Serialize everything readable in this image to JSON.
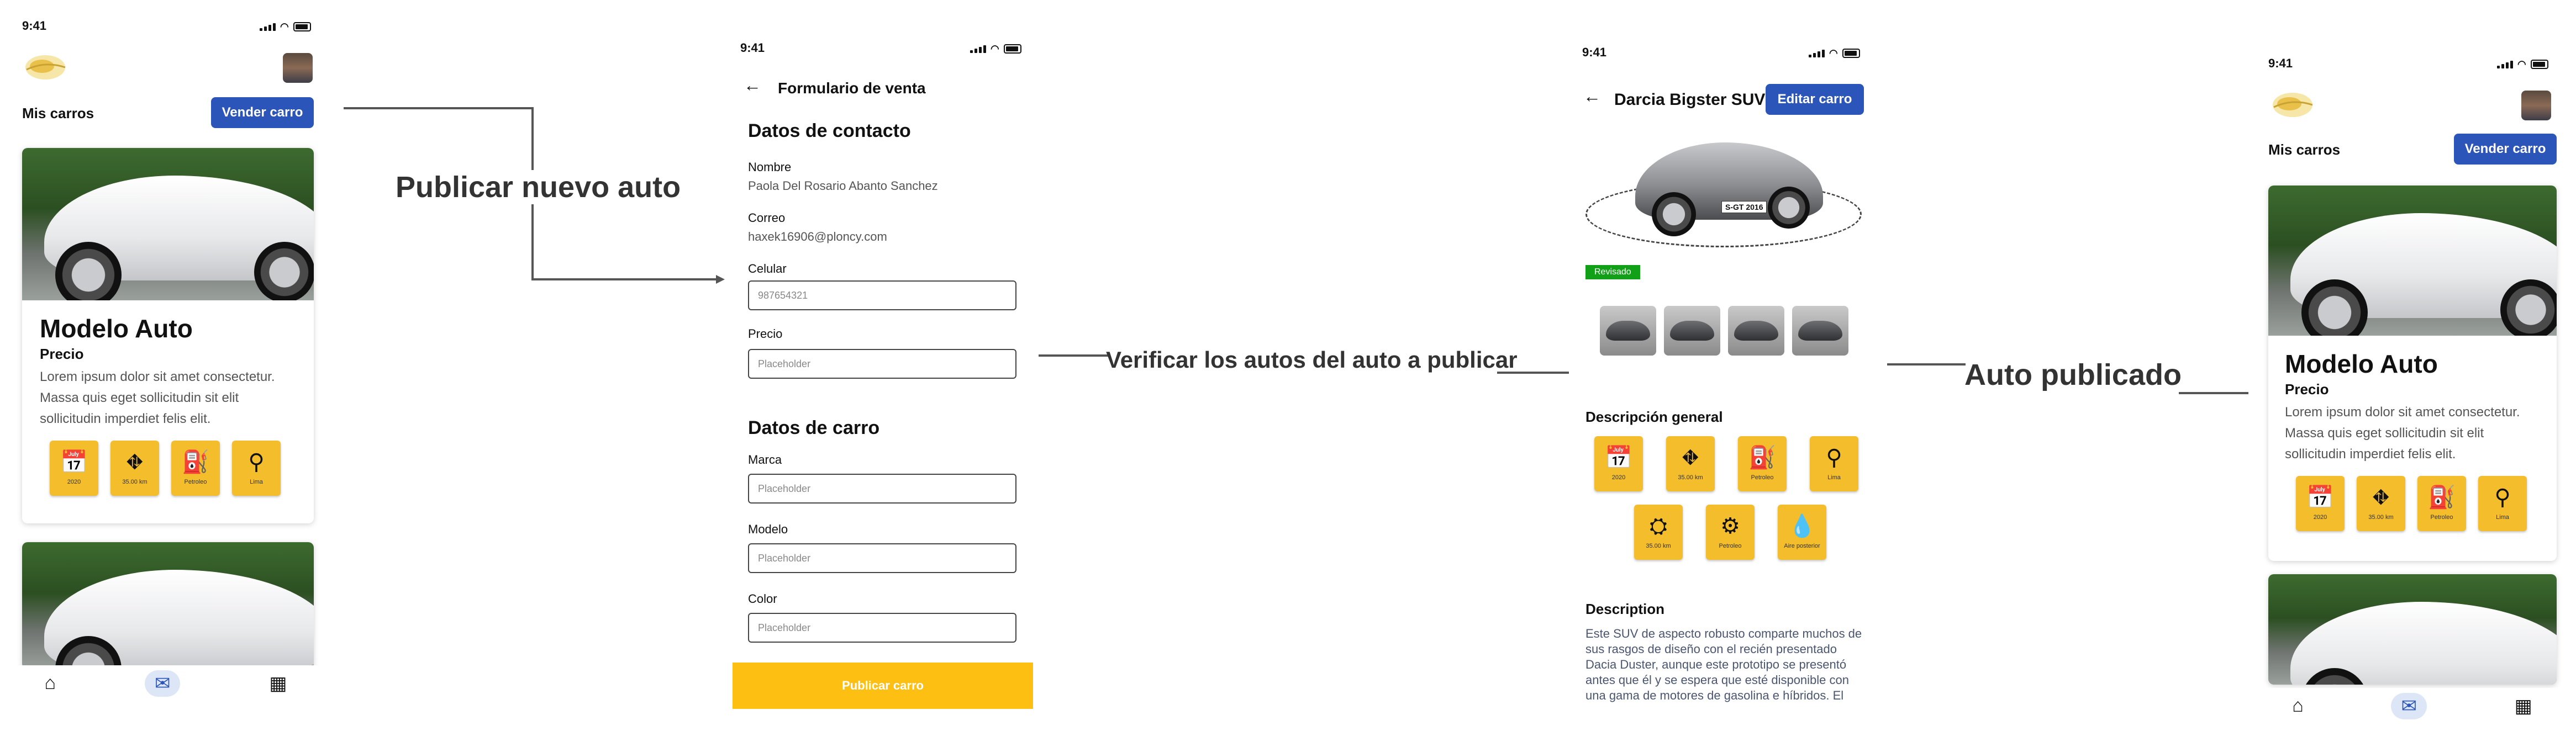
{
  "status": {
    "time": "9:41"
  },
  "flow": {
    "step1": "Publicar nuevo auto",
    "step2": "Verificar los autos del auto a publicar",
    "step3": "Auto publicado"
  },
  "list_screen": {
    "title": "Mis carros",
    "sell_button": "Vender carro",
    "card": {
      "model": "Modelo Auto",
      "price": "Precio",
      "description": "Lorem ipsum dolor sit amet consectetur. Massa quis eget sollicitudin sit elit sollicitudin imperdiet felis elit.",
      "features": [
        {
          "icon": "calendar-icon",
          "glyph": "📅",
          "label": "2020"
        },
        {
          "icon": "road-icon",
          "glyph": "⛖",
          "label": "35.00 km"
        },
        {
          "icon": "fuel-icon",
          "glyph": "⛽",
          "label": "Petroleo"
        },
        {
          "icon": "location-icon",
          "glyph": "⚲",
          "label": "Lima"
        }
      ]
    }
  },
  "form_screen": {
    "title": "Formulario de venta",
    "contact_section": "Datos de contacto",
    "name_label": "Nombre",
    "name_value": "Paola Del Rosario Abanto Sanchez",
    "email_label": "Correo",
    "email_value": "haxek16906@ploncy.com",
    "phone_label": "Celular",
    "phone_placeholder": "987654321",
    "price_label": "Precio",
    "price_placeholder": "Placeholder",
    "car_section": "Datos de carro",
    "brand_label": "Marca",
    "brand_placeholder": "Placeholder",
    "model_label": "Modelo",
    "model_placeholder": "Placeholder",
    "color_label": "Color",
    "color_placeholder": "Placeholder",
    "publish_button": "Publicar carro"
  },
  "detail_screen": {
    "title": "Darcia Bigster SUV",
    "edit_button": "Editar carro",
    "plate": "S-GT 2016",
    "badge": "Revisado",
    "badge_color": "#12a019",
    "overview_title": "Descripción general",
    "features_row1": [
      {
        "icon": "calendar-icon",
        "glyph": "📅",
        "label": "2020"
      },
      {
        "icon": "road-icon",
        "glyph": "⛖",
        "label": "35.00 km"
      },
      {
        "icon": "fuel-icon",
        "glyph": "⛽",
        "label": "Petroleo"
      },
      {
        "icon": "location-icon",
        "glyph": "⚲",
        "label": "Lima"
      }
    ],
    "features_row2": [
      {
        "icon": "gearbox-icon",
        "glyph": "⛭",
        "label": "35.00 km"
      },
      {
        "icon": "engine-icon",
        "glyph": "⚙",
        "label": "Petroleo"
      },
      {
        "icon": "oil-drop-icon",
        "glyph": "💧",
        "label": "Aire posterior"
      }
    ],
    "description_title": "Description",
    "description": "Este SUV de aspecto robusto comparte muchos de sus rasgos de diseño con el recién presentado Dacia Duster, aunque este prototipo se presentó antes que él y se espera que esté disponible con una gama de motores de gasolina e híbridos. El"
  },
  "colors": {
    "accent_blue": "#2b55b8",
    "feature_yellow": "#f3bd2c",
    "publish_yellow": "#fdbf11"
  }
}
